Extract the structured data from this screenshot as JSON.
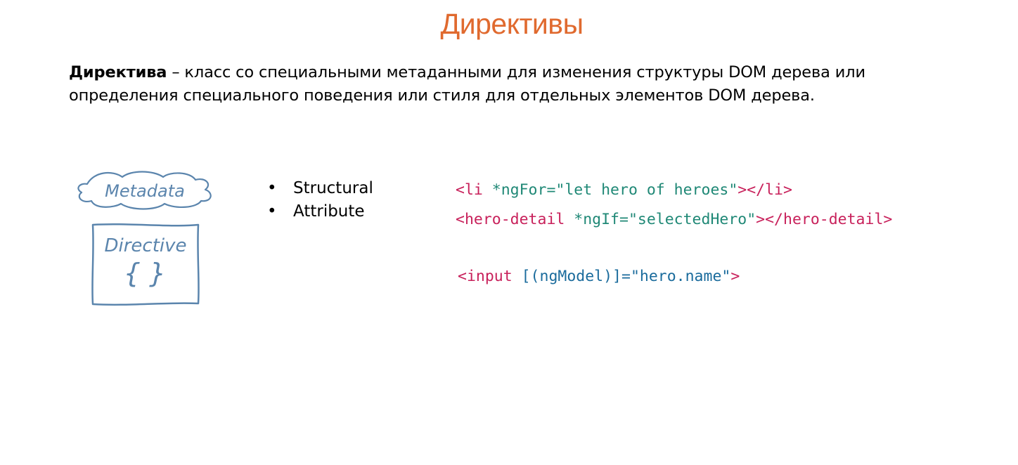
{
  "slide": {
    "title": "Директивы",
    "definition": {
      "term": "Директива",
      "text": " – класс со специальными метаданными для изменения структуры DOM дерева или определения специального поведения или стиля для отдельных элементов DOM дерева."
    },
    "diagram": {
      "cloud_label": "Metadata",
      "box_label": "Directive",
      "box_glyph": "{ }"
    },
    "bullets": [
      "Structural",
      "Attribute"
    ],
    "code_examples": [
      {
        "open_tag": "<li ",
        "attr": "*ngFor=",
        "value": "\"let hero of heroes\"",
        "close": "></li>"
      },
      {
        "open_tag": "<hero-detail ",
        "attr": "*ngIf=",
        "value": "\"selectedHero\"",
        "close": "></hero-detail>"
      },
      {
        "open_tag": "<input ",
        "attr": "[(ngModel)]=",
        "value": "\"hero.name\"",
        "close": ">"
      }
    ],
    "colors": {
      "title": "#e06a2f",
      "tag": "#c8215b",
      "attribute": "#1f8876",
      "model_binding": "#1a6b9c",
      "sketch": "#5b85ad"
    }
  }
}
